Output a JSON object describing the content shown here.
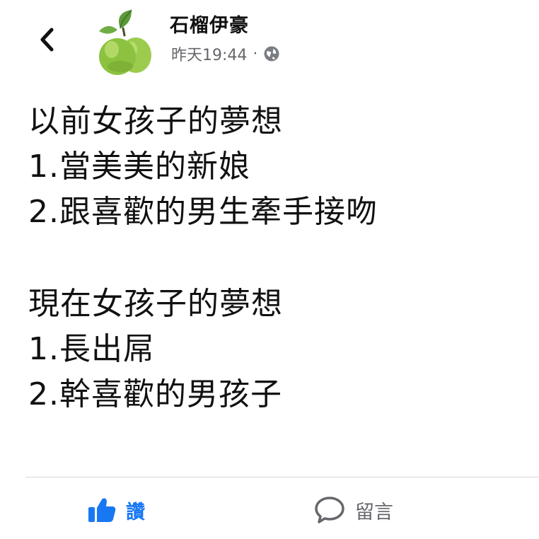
{
  "header": {
    "author_name": "石榴伊豪",
    "timestamp": "昨天19:44",
    "separator": "·",
    "back_icon": "chevron-left-icon",
    "privacy_icon": "globe-icon"
  },
  "post": {
    "lines": [
      "以前女孩子的夢想",
      "1.當美美的新娘",
      "2.跟喜歡的男生牽手接吻",
      "現在女孩子的夢想",
      "1.長出屌",
      "2.幹喜歡的男孩子"
    ]
  },
  "actions": {
    "like_label": "讚",
    "like_icon": "thumbs-up-icon",
    "comment_label": "留言",
    "comment_icon": "comment-bubble-icon"
  },
  "colors": {
    "like_accent": "#1877f2",
    "muted_text": "#65676b"
  }
}
